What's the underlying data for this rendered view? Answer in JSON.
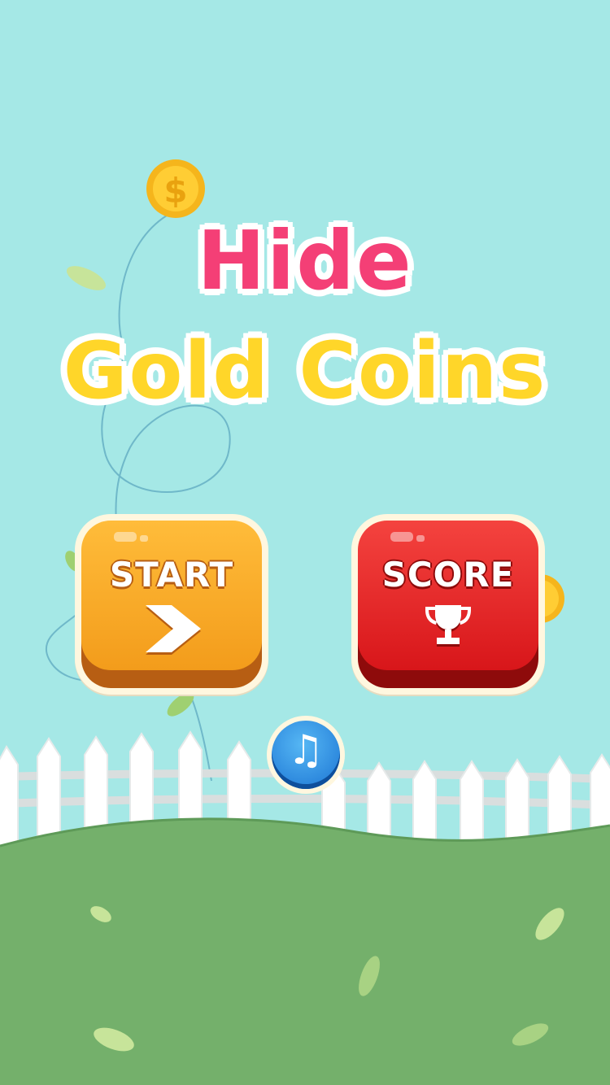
{
  "title": {
    "line1": "Hide",
    "line2": "Gold Coins"
  },
  "buttons": {
    "start": {
      "label": "START",
      "icon": "chevron-right-icon"
    },
    "score": {
      "label": "SCORE",
      "icon": "trophy-icon"
    },
    "music": {
      "icon": "music-note-icon",
      "glyph": "♫"
    }
  },
  "colors": {
    "sky": "#a5e8e6",
    "grass": "#74b06b",
    "title_pink": "#f43f76",
    "title_yellow": "#ffd629",
    "start_orange": "#f39c1b",
    "score_red": "#d8161a",
    "music_blue": "#1a73d3"
  }
}
